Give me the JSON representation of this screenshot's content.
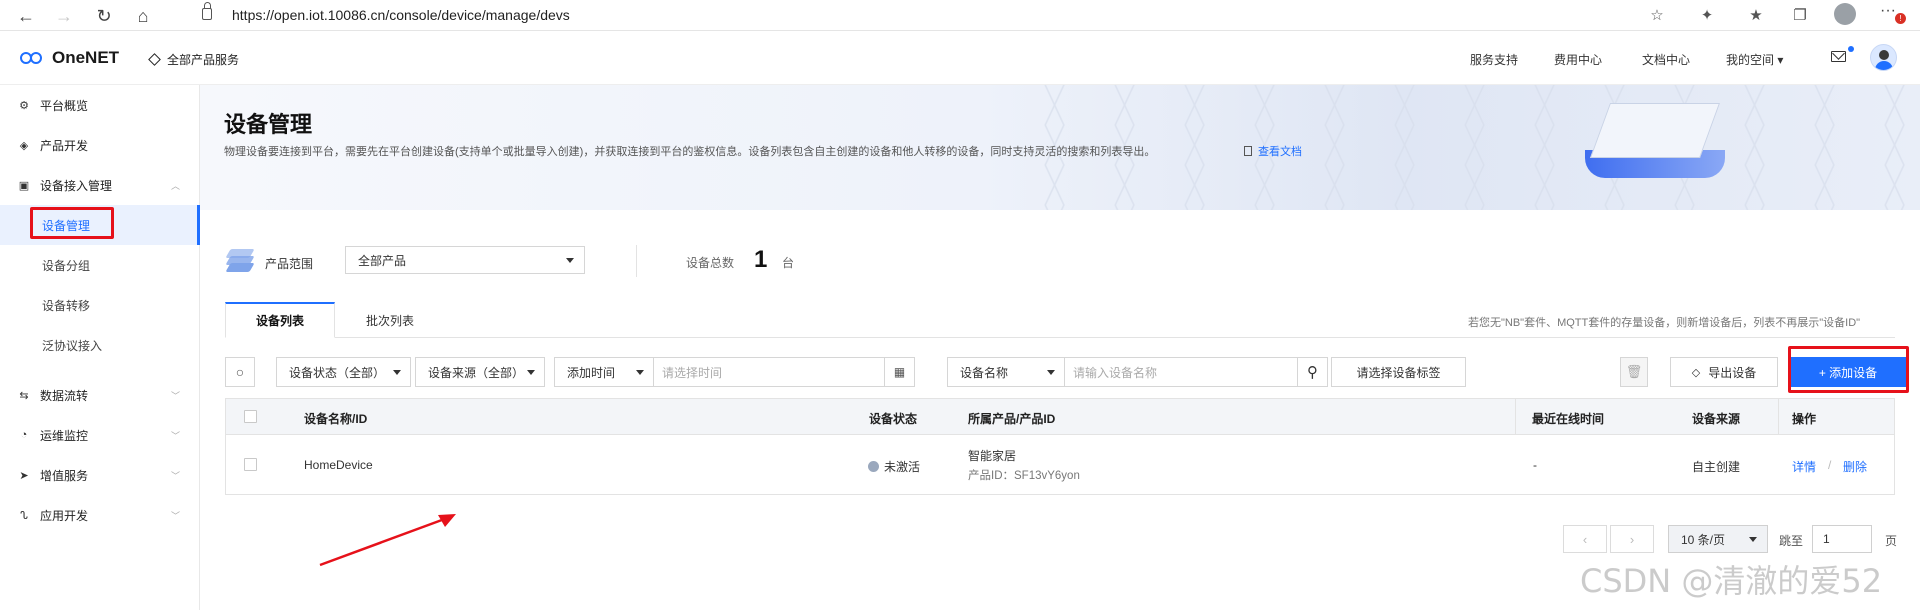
{
  "browser": {
    "url": "https://open.iot.10086.cn/console/device/manage/devs"
  },
  "header": {
    "logo": "OneNET",
    "all_products": "全部产品服务",
    "links": [
      "服务支持",
      "费用中心",
      "文档中心",
      "我的空间"
    ]
  },
  "sidebar": {
    "items": [
      {
        "label": "平台概览",
        "icon": "dashboard-icon"
      },
      {
        "label": "产品开发",
        "icon": "cube-icon"
      },
      {
        "label": "设备接入管理",
        "icon": "device-icon",
        "expanded": true
      },
      {
        "label": "数据流转",
        "icon": "flow-icon"
      },
      {
        "label": "运维监控",
        "icon": "monitor-icon"
      },
      {
        "label": "增值服务",
        "icon": "send-icon"
      },
      {
        "label": "应用开发",
        "icon": "app-icon"
      }
    ],
    "sub_items": [
      {
        "label": "设备管理",
        "active": true
      },
      {
        "label": "设备分组"
      },
      {
        "label": "设备转移"
      },
      {
        "label": "泛协议接入"
      }
    ]
  },
  "banner": {
    "title": "设备管理",
    "description": "物理设备要连接到平台，需要先在平台创建设备(支持单个或批量导入创建)，并获取连接到平台的鉴权信息。设备列表包含自主创建的设备和他人转移的设备，同时支持灵活的搜索和列表导出。",
    "doc_link": "查看文档"
  },
  "filter": {
    "product_scope_label": "产品范围",
    "product_scope_value": "全部产品",
    "total_label": "设备总数",
    "total_value": "1",
    "total_unit": "台"
  },
  "tabs": {
    "items": [
      "设备列表",
      "批次列表"
    ],
    "note": "若您无\"NB\"套件、MQTT套件的存量设备，则新增设备后，列表不再展示\"设备ID\""
  },
  "toolbar": {
    "status_select": "设备状态（全部）",
    "source_select": "设备来源（全部）",
    "time_select": "添加时间",
    "time_placeholder": "请选择时间",
    "name_select": "设备名称",
    "name_placeholder": "请输入设备名称",
    "tag_button": "请选择设备标签",
    "export_button": "导出设备",
    "add_button": "+ 添加设备"
  },
  "table": {
    "columns": [
      "设备名称/ID",
      "设备状态",
      "所属产品/产品ID",
      "最近在线时间",
      "设备来源",
      "操作"
    ],
    "rows": [
      {
        "name": "HomeDevice",
        "status": "未激活",
        "product": "智能家居",
        "product_id": "产品ID：SF13vY6yon",
        "last_online": "-",
        "source": "自主创建",
        "action_detail": "详情",
        "action_sep": "/",
        "action_delete": "删除"
      }
    ]
  },
  "pagination": {
    "page_size": "10 条/页",
    "jump_label": "跳至",
    "jump_value": "1",
    "page_unit": "页"
  },
  "watermark": "CSDN @清澈的爱52",
  "colors": {
    "accent": "#1f6fff",
    "highlight": "#e6111a"
  }
}
